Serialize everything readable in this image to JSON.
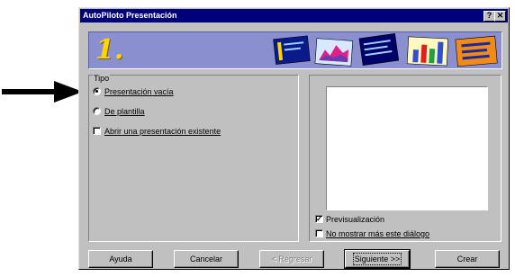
{
  "window": {
    "title": "AutoPiloto Presentación",
    "help_label": "?",
    "close_label": "✕"
  },
  "banner": {
    "step": "1."
  },
  "tipo_group": {
    "label": "Tipo",
    "options": [
      {
        "label": "Presentación vacía",
        "selected": true
      },
      {
        "label": "De plantilla",
        "selected": false
      }
    ],
    "open_existing": {
      "label": "Abrir una presentación existente",
      "checked": false
    }
  },
  "preview_group": {
    "preview_checkbox": {
      "label": "Previsualización",
      "checked": true
    },
    "dont_show_checkbox": {
      "label": "No mostrar más este diálogo",
      "checked": false
    }
  },
  "buttons": {
    "help": "Ayuda",
    "cancel": "Cancelar",
    "back": "< Regresar",
    "next": "Siguiente >>",
    "finish": "Crear"
  },
  "colors": {
    "titlebar": "#00007b",
    "banner": "#8a8fcf",
    "step_number": "#ffd400",
    "face": "#c0c0c0"
  }
}
